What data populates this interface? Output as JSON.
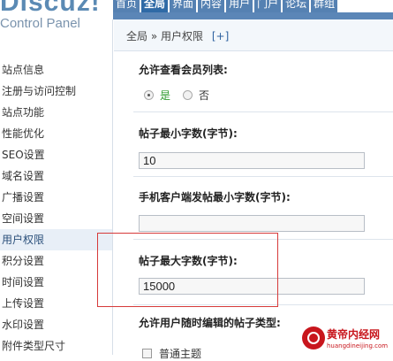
{
  "header": {
    "logo": "Discuz!",
    "subtitle": "Control Panel",
    "nav": [
      {
        "label": "首页",
        "active": false
      },
      {
        "label": "全局",
        "active": true
      },
      {
        "label": "界面",
        "active": false
      },
      {
        "label": "内容",
        "active": false
      },
      {
        "label": "用户",
        "active": false
      },
      {
        "label": "门户",
        "active": false
      },
      {
        "label": "论坛",
        "active": false
      },
      {
        "label": "群组",
        "active": false
      }
    ]
  },
  "sidebar": {
    "items": [
      {
        "label": "站点信息"
      },
      {
        "label": "注册与访问控制"
      },
      {
        "label": "站点功能"
      },
      {
        "label": "性能优化"
      },
      {
        "label": "SEO设置"
      },
      {
        "label": "域名设置"
      },
      {
        "label": "广播设置"
      },
      {
        "label": "空间设置"
      },
      {
        "label": "用户权限"
      },
      {
        "label": "积分设置"
      },
      {
        "label": "时间设置"
      },
      {
        "label": "上传设置"
      },
      {
        "label": "水印设置"
      },
      {
        "label": "附件类型尺寸"
      }
    ],
    "active_index": 8
  },
  "breadcrumb": {
    "root": "全局",
    "sep": "»",
    "current": "用户权限",
    "add": "[+]"
  },
  "settings": {
    "member_list": {
      "label": "允许查看会员列表:",
      "yes": "是",
      "no": "否",
      "selected": "是"
    },
    "min_post": {
      "label": "帖子最小字数(字节):",
      "value": "10"
    },
    "mobile_min_post": {
      "label": "手机客户端发帖最小字数(字节):",
      "value": ""
    },
    "max_post": {
      "label": "帖子最大字数(字节):",
      "value": "15000"
    },
    "edit_types": {
      "label": "允许用户随时编辑的帖子类型:",
      "option": "普通主题"
    }
  },
  "watermark": {
    "title": "黄帝内经网",
    "url": "huangdineijing.com"
  },
  "colors": {
    "nav_bg": "#5581b2",
    "nav_active": "#2f6aa6",
    "highlight": "#d63a3a",
    "radio_yes": "#2e9a2e",
    "watermark": "#c8161d"
  }
}
